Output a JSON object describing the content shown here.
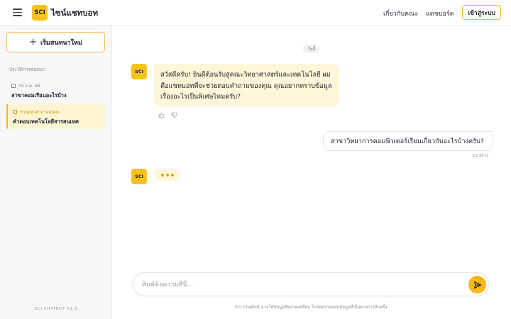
{
  "header": {
    "logo_text": "SCI",
    "brand": "ไซน์แชทบอท",
    "nav": [
      "เกี่ยวกับคณะ",
      "แดชบอร์ด"
    ],
    "login_label": "เข้าสู่ระบบ"
  },
  "sidebar": {
    "new_chat_label": "เริ่มสนทนาใหม่",
    "history_label": "ประวัติการสนทนา",
    "items": [
      {
        "meta": "15 ธ.ค. 68",
        "title": "สาขาคอมเรียนอะไรบ้าง",
        "active": false
      },
      {
        "meta": "ช่วยตอบคำถามหน่อย",
        "title": "คำตอบเทคโนโลยีสารสนเทศ",
        "active": true
      }
    ],
    "version": "SCI CHATBOT V1.0"
  },
  "chat": {
    "day_label": "วันนี้",
    "bot_avatar": "SCI",
    "bot_message": "สวัสดีครับ! ยินดีต้อนรับสู่คณะวิทยาศาสตร์และเทคโนโลยี ผมคือแชทบอทที่จะช่วยตอบคำถามของคุณ คุณอยากทราบข้อมูลเรื่องอะไรเป็นพิเศษไหมครับ?",
    "user_message": "สาขาวิทยาการคอมพิวเตอร์เรียนเกี่ยวกับอะไรบ้างครับ?",
    "user_time": "10:30 น.",
    "typing_avatar": "SCI"
  },
  "composer": {
    "placeholder": "พิมพ์ข้อความที่นี่...",
    "disclaimer": "SCI Chatbot อาจให้ข้อมูลที่คลาดเคลื่อน โปรดตรวจสอบข้อมูลที่เป็นทางการอีกครั้ง"
  },
  "colors": {
    "accent": "#f8c21c",
    "bot_bubble": "#fdf6d8",
    "active_item": "#fdf4d4"
  },
  "icons": [
    "menu-icon",
    "plus-icon",
    "calendar-icon",
    "thumbs-up-icon",
    "thumbs-down-icon",
    "send-icon"
  ]
}
